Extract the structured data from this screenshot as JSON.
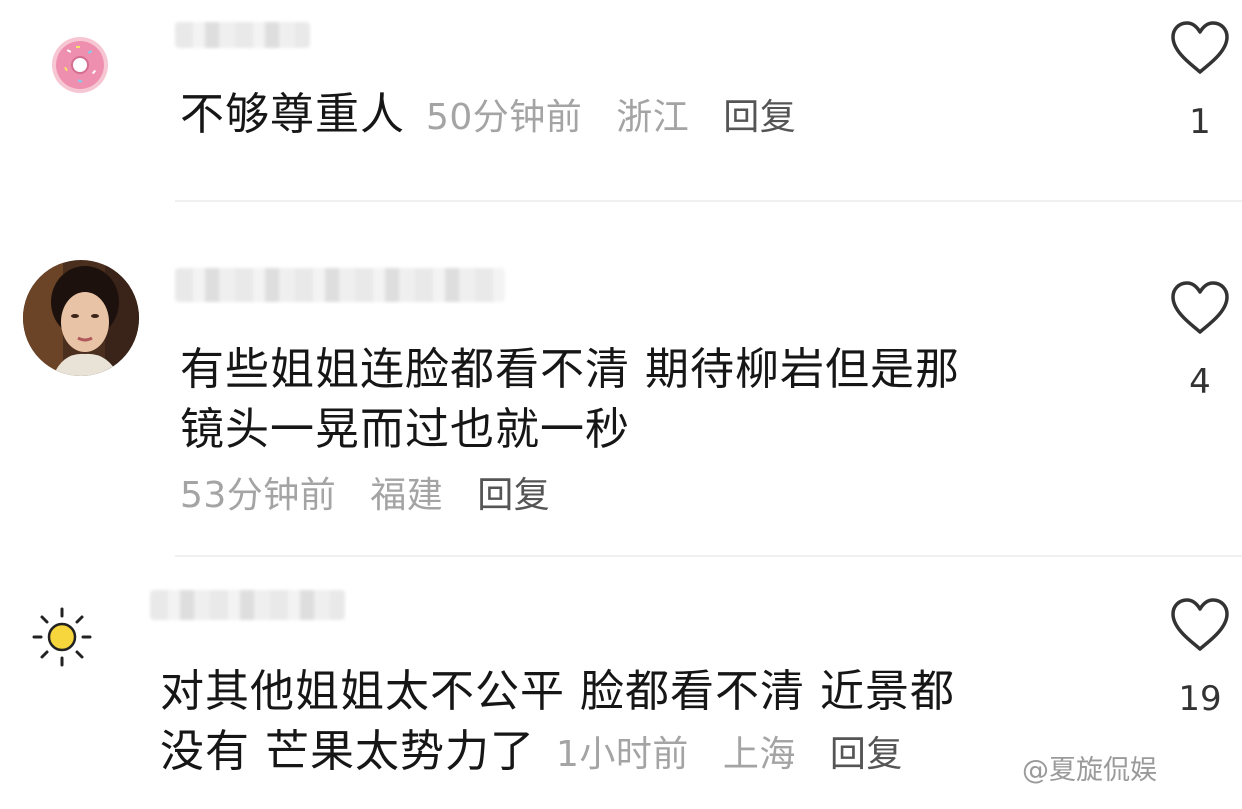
{
  "comments": [
    {
      "text": "不够尊重人",
      "time": "50分钟前",
      "location": "浙江",
      "reply": "回复",
      "likes": "1",
      "avatar": "donut-icon"
    },
    {
      "text_line1": "有些姐姐连脸都看不清 期待柳岩但是那",
      "text_line2": "镜头一晃而过也就一秒",
      "time": "53分钟前",
      "location": "福建",
      "reply": "回复",
      "likes": "4",
      "avatar": "woman-portrait"
    },
    {
      "text_line1": "对其他姐姐太不公平 脸都看不清 近景都",
      "text_line2": "没有 芒果太势力了",
      "time": "1小时前",
      "location": "上海",
      "reply": "回复",
      "likes": "19",
      "avatar": "sun-icon"
    }
  ],
  "watermark": "@夏旋侃娱",
  "colors": {
    "text": "#161616",
    "meta": "#a4a4a4",
    "reply": "#555555",
    "heart": "#333333"
  }
}
